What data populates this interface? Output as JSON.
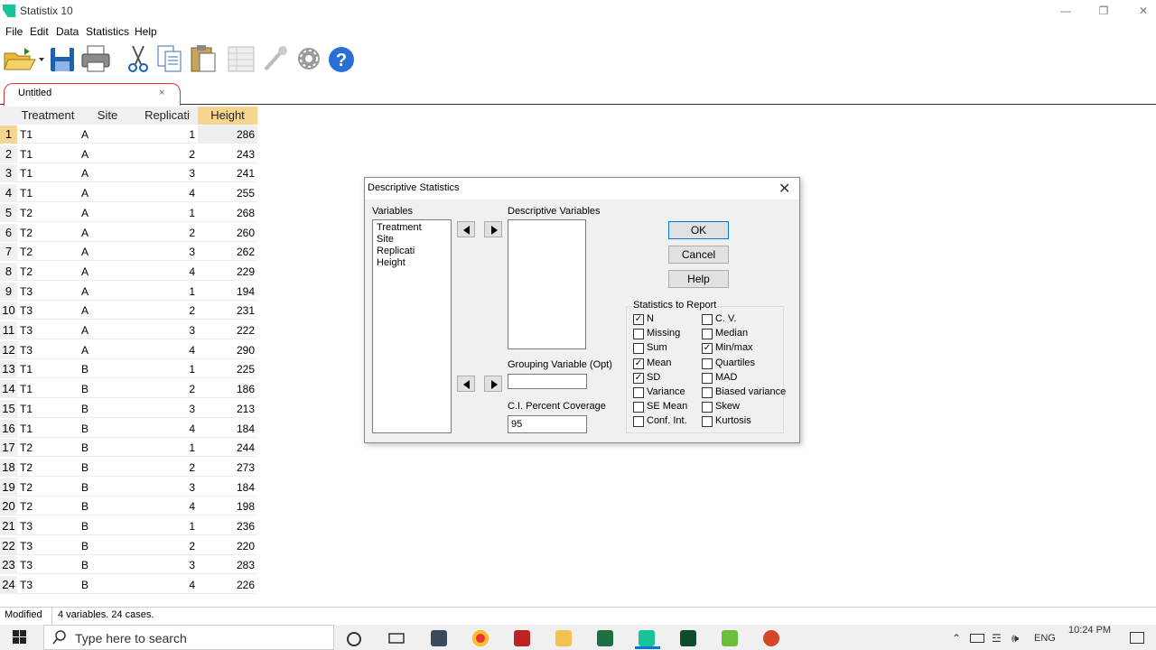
{
  "window": {
    "title": "Statistix 10"
  },
  "menu": [
    "File",
    "Edit",
    "Data",
    "Statistics",
    "Help"
  ],
  "toolbar": {
    "buttons": [
      "open-icon",
      "save-icon",
      "print-icon",
      "cut-icon",
      "copy-icon",
      "paste-icon",
      "spreadsheet-icon",
      "eyedropper-icon",
      "gear-icon",
      "help-icon"
    ]
  },
  "tab": {
    "label": "Untitled",
    "close": "×"
  },
  "grid": {
    "headers": [
      "Treatment",
      "Site",
      "Replicati",
      "Height"
    ],
    "rows": [
      [
        "1",
        "T1",
        "A",
        "1",
        "286"
      ],
      [
        "2",
        "T1",
        "A",
        "2",
        "243"
      ],
      [
        "3",
        "T1",
        "A",
        "3",
        "241"
      ],
      [
        "4",
        "T1",
        "A",
        "4",
        "255"
      ],
      [
        "5",
        "T2",
        "A",
        "1",
        "268"
      ],
      [
        "6",
        "T2",
        "A",
        "2",
        "260"
      ],
      [
        "7",
        "T2",
        "A",
        "3",
        "262"
      ],
      [
        "8",
        "T2",
        "A",
        "4",
        "229"
      ],
      [
        "9",
        "T3",
        "A",
        "1",
        "194"
      ],
      [
        "10",
        "T3",
        "A",
        "2",
        "231"
      ],
      [
        "11",
        "T3",
        "A",
        "3",
        "222"
      ],
      [
        "12",
        "T3",
        "A",
        "4",
        "290"
      ],
      [
        "13",
        "T1",
        "B",
        "1",
        "225"
      ],
      [
        "14",
        "T1",
        "B",
        "2",
        "186"
      ],
      [
        "15",
        "T1",
        "B",
        "3",
        "213"
      ],
      [
        "16",
        "T1",
        "B",
        "4",
        "184"
      ],
      [
        "17",
        "T2",
        "B",
        "1",
        "244"
      ],
      [
        "18",
        "T2",
        "B",
        "2",
        "273"
      ],
      [
        "19",
        "T2",
        "B",
        "3",
        "184"
      ],
      [
        "20",
        "T2",
        "B",
        "4",
        "198"
      ],
      [
        "21",
        "T3",
        "B",
        "1",
        "236"
      ],
      [
        "22",
        "T3",
        "B",
        "2",
        "220"
      ],
      [
        "23",
        "T3",
        "B",
        "3",
        "283"
      ],
      [
        "24",
        "T3",
        "B",
        "4",
        "226"
      ]
    ]
  },
  "dialog": {
    "title": "Descriptive Statistics",
    "variables_label": "Variables",
    "variables": [
      "Treatment",
      "Site",
      "Replicati",
      "Height"
    ],
    "descriptive_variables_label": "Descriptive Variables",
    "grouping_label": "Grouping Variable (Opt)",
    "grouping_value": "",
    "ci_label": "C.I. Percent Coverage",
    "ci_value": "95",
    "ok": "OK",
    "cancel": "Cancel",
    "help": "Help",
    "stats_group_label": "Statistics to Report",
    "stats_left": [
      {
        "label": "N",
        "checked": true
      },
      {
        "label": "Missing",
        "checked": false
      },
      {
        "label": "Sum",
        "checked": false
      },
      {
        "label": "Mean",
        "checked": true
      },
      {
        "label": "SD",
        "checked": true
      },
      {
        "label": "Variance",
        "checked": false
      },
      {
        "label": "SE Mean",
        "checked": false
      },
      {
        "label": "Conf. Int.",
        "checked": false
      }
    ],
    "stats_right": [
      {
        "label": "C. V.",
        "checked": false
      },
      {
        "label": "Median",
        "checked": false
      },
      {
        "label": "Min/max",
        "checked": true
      },
      {
        "label": "Quartiles",
        "checked": false
      },
      {
        "label": "MAD",
        "checked": false
      },
      {
        "label": "Biased variance",
        "checked": false
      },
      {
        "label": "Skew",
        "checked": false
      },
      {
        "label": "Kurtosis",
        "checked": false
      }
    ]
  },
  "status": {
    "left": "Modified",
    "right": "4 variables. 24 cases."
  },
  "taskbar": {
    "search_placeholder": "Type here to search",
    "lang": "ENG",
    "time": "10:24 PM"
  }
}
